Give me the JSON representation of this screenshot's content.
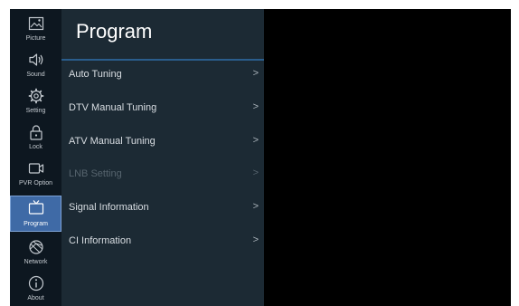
{
  "sidebar": {
    "items": [
      {
        "label": "Picture",
        "icon": "picture-icon"
      },
      {
        "label": "Sound",
        "icon": "speaker-icon"
      },
      {
        "label": "Setting",
        "icon": "gear-icon"
      },
      {
        "label": "Lock",
        "icon": "lock-icon"
      },
      {
        "label": "PVR Option",
        "icon": "video-camera-icon"
      },
      {
        "label": "Program",
        "icon": "tv-icon",
        "active": true
      },
      {
        "label": "Network",
        "icon": "globe-icon"
      },
      {
        "label": "About",
        "icon": "info-icon"
      }
    ]
  },
  "panel": {
    "title": "Program",
    "items": [
      {
        "label": "Auto Tuning",
        "chevron": ">",
        "enabled": true
      },
      {
        "label": "DTV Manual Tuning",
        "chevron": ">",
        "enabled": true
      },
      {
        "label": "ATV Manual Tuning",
        "chevron": ">",
        "enabled": true
      },
      {
        "label": "LNB Setting",
        "chevron": ">",
        "enabled": false
      },
      {
        "label": "Signal Information",
        "chevron": ">",
        "enabled": true
      },
      {
        "label": "CI Information",
        "chevron": ">",
        "enabled": true
      }
    ]
  },
  "colors": {
    "sidebar_bg": "#0d1720",
    "panel_bg": "#1c2a34",
    "active_bg": "#3f6aa6",
    "accent_rule": "#2a5d8c",
    "disabled_text": "#56646e"
  }
}
